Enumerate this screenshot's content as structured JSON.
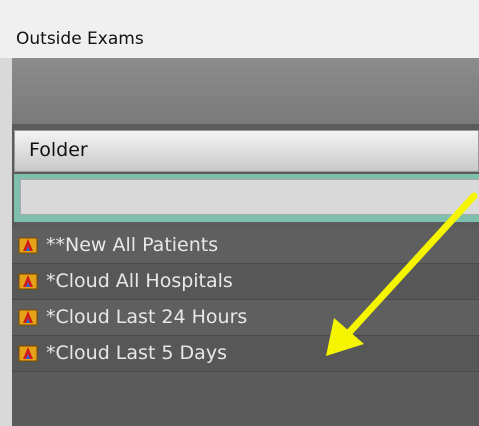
{
  "window": {
    "title": "Outside Exams"
  },
  "folder_header": {
    "label": "Folder"
  },
  "filter": {
    "value": "",
    "placeholder": ""
  },
  "folders": [
    {
      "label": "**New All Patients",
      "icon": "folder-icon"
    },
    {
      "label": "*Cloud All Hospitals",
      "icon": "folder-icon"
    },
    {
      "label": "*Cloud Last 24 Hours",
      "icon": "folder-icon"
    },
    {
      "label": "*Cloud Last 5 Days",
      "icon": "folder-icon"
    }
  ],
  "annotation": {
    "type": "arrow",
    "color": "#f5f500",
    "points_to": "*Cloud Last 24 Hours"
  },
  "colors": {
    "title_bar": "#f0f0f0",
    "panel": "#5b5b5b",
    "filter_border": "#7fbfad",
    "row_text": "#e8e8e8",
    "arrow": "#f5f500"
  }
}
